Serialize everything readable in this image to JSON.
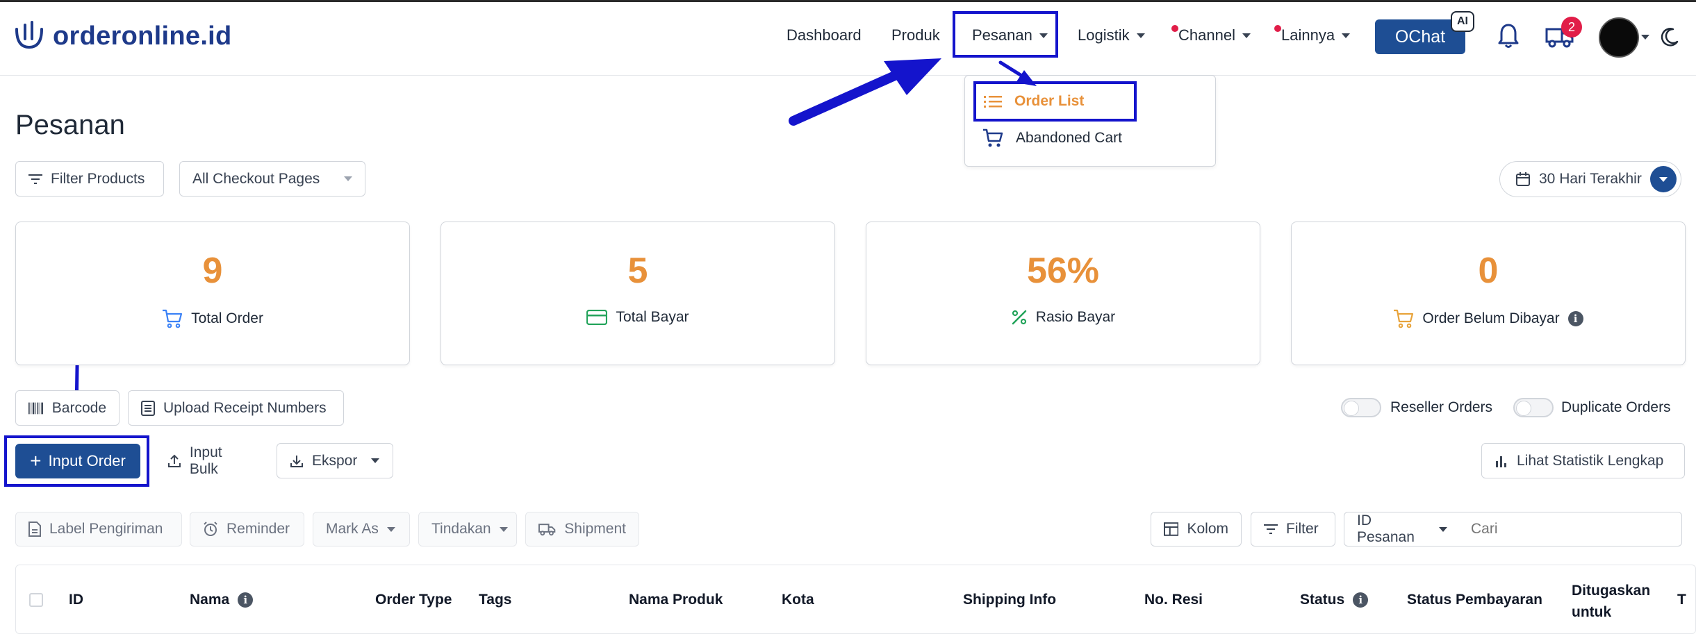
{
  "brand": {
    "name": "orderonline.id"
  },
  "nav": {
    "dashboard": "Dashboard",
    "produk": "Produk",
    "pesanan": "Pesanan",
    "logistik": "Logistik",
    "channel": "Channel",
    "lainnya": "Lainnya",
    "ochat": "OChat",
    "ai_badge": "AI",
    "cart_badge": "2"
  },
  "dropdown": {
    "order_list": "Order List",
    "abandoned_cart": "Abandoned Cart"
  },
  "page": {
    "title": "Pesanan"
  },
  "filters": {
    "filter_products": "Filter Products",
    "checkout_pages": "All Checkout Pages",
    "date_range": "30 Hari Terakhir"
  },
  "stats": [
    {
      "value": "9",
      "label": "Total Order"
    },
    {
      "value": "5",
      "label": "Total Bayar"
    },
    {
      "value": "56%",
      "label": "Rasio Bayar"
    },
    {
      "value": "0",
      "label": "Order Belum Dibayar"
    }
  ],
  "actions": {
    "barcode": "Barcode",
    "upload_receipt": "Upload Receipt Numbers",
    "reseller_orders": "Reseller Orders",
    "duplicate_orders": "Duplicate Orders",
    "input_order": "Input Order",
    "input_bulk": "Input Bulk",
    "ekspor": "Ekspor",
    "lihat_statistik": "Lihat Statistik Lengkap"
  },
  "toolbar": {
    "label_pengiriman": "Label Pengiriman",
    "reminder": "Reminder",
    "mark_as": "Mark As",
    "tindakan": "Tindakan",
    "shipment": "Shipment",
    "kolom": "Kolom",
    "filter": "Filter",
    "search_field": "ID Pesanan",
    "search_placeholder": "Cari"
  },
  "table": {
    "headers": [
      "ID",
      "Nama",
      "Order Type",
      "Tags",
      "Nama Produk",
      "Kota",
      "Shipping Info",
      "No. Resi",
      "Status",
      "Status Pembayaran",
      "Ditugaskan untuk",
      "T"
    ]
  },
  "colors": {
    "primary": "#1e4e94",
    "accent": "#e8913a",
    "annotation": "#1414cc"
  }
}
